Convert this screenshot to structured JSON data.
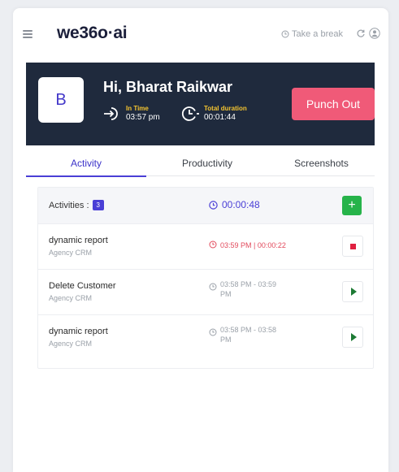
{
  "app": {
    "logo": "we36o·ai",
    "break_label": "Take a break"
  },
  "header": {
    "avatar_letter": "B",
    "greeting": "Hi, Bharat Raikwar",
    "in_time_label": "In Time",
    "in_time_value": "03:57 pm",
    "duration_label": "Total duration",
    "duration_value": "00:01:44",
    "punch_out_label": "Punch Out"
  },
  "tabs": [
    {
      "label": "Activity",
      "active": true
    },
    {
      "label": "Productivity",
      "active": false
    },
    {
      "label": "Screenshots",
      "active": false
    }
  ],
  "activities": {
    "label": "Activities :",
    "count": "3",
    "total_time": "00:00:48",
    "add_label": "+",
    "items": [
      {
        "name": "dynamic report",
        "project": "Agency CRM",
        "time": "03:59 PM | 00:00:22",
        "state": "running"
      },
      {
        "name": "Delete Customer",
        "project": "Agency CRM",
        "time": "03:58 PM - 03:59 PM",
        "state": "stopped"
      },
      {
        "name": "dynamic report",
        "project": "Agency CRM",
        "time": "03:58 PM - 03:58 PM",
        "state": "stopped"
      }
    ]
  },
  "colors": {
    "accent": "#4a3fd6",
    "header_bg": "#1f2a3d",
    "punch_out": "#f05a78",
    "add_green": "#26b34a",
    "running_red": "#e24a5c"
  },
  "icons": [
    "menu-icon",
    "clock-icon",
    "refresh-icon",
    "user-icon",
    "login-icon",
    "timer-icon",
    "plus-icon",
    "stop-icon",
    "play-icon"
  ]
}
